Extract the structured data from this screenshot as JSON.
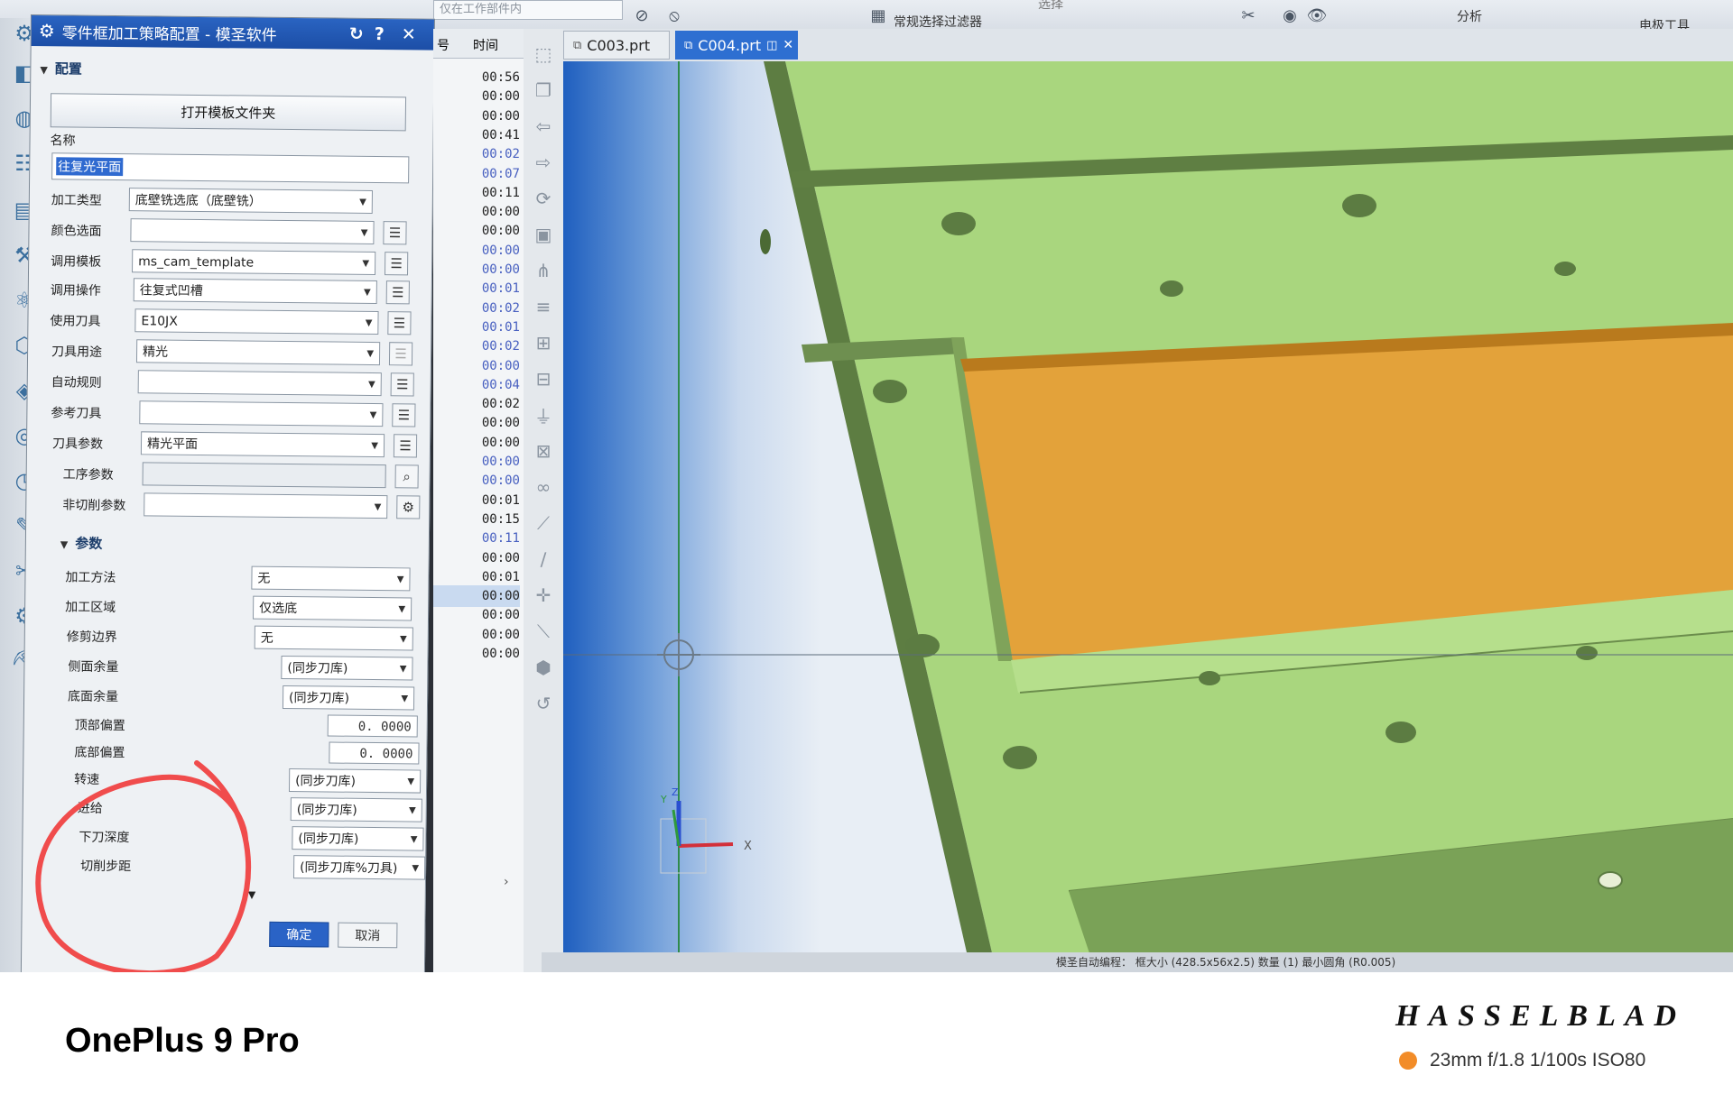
{
  "ribbon": {
    "filter_combo": "仅在工作部件内",
    "select_filter": "常规选择过滤器",
    "top_label": "选择",
    "analysis": "分析",
    "electrode_tools": "电极工具"
  },
  "dialog": {
    "title": "零件框加工策略配置 - 模圣软件",
    "reset_icon": "↻",
    "help_icon": "?",
    "close_icon": "✕",
    "config_section": "配置",
    "open_template_folder": "打开模板文件夹",
    "name_label": "名称",
    "name_value": "往复光平面",
    "rows": [
      {
        "label": "加工类型",
        "value": "底壁铣选底（底壁铣）"
      },
      {
        "label": "颜色选面",
        "value": ""
      },
      {
        "label": "调用模板",
        "value": "ms_cam_template"
      },
      {
        "label": "调用操作",
        "value": "往复式凹槽"
      },
      {
        "label": "使用刀具",
        "value": "E10JX"
      },
      {
        "label": "刀具用途",
        "value": "精光"
      },
      {
        "label": "自动规则",
        "value": ""
      },
      {
        "label": "参考刀具",
        "value": ""
      },
      {
        "label": "刀具参数",
        "value": "精光平面"
      },
      {
        "label": "工序参数",
        "value": ""
      },
      {
        "label": "非切削参数",
        "value": ""
      }
    ],
    "params_section": "参数",
    "params": [
      {
        "label": "加工方法",
        "value": "无"
      },
      {
        "label": "加工区域",
        "value": "仅选底"
      },
      {
        "label": "修剪边界",
        "value": "无"
      },
      {
        "label": "侧面余量",
        "value": "(同步刀库)"
      },
      {
        "label": "底面余量",
        "value": "(同步刀库)"
      },
      {
        "label": "顶部偏置",
        "value": "0. 0000"
      },
      {
        "label": "底部偏置",
        "value": "0. 0000"
      },
      {
        "label": "转速",
        "value": "(同步刀库)"
      },
      {
        "label": "进给",
        "value": "(同步刀库)"
      },
      {
        "label": "下刀深度",
        "value": "(同步刀库)"
      },
      {
        "label": "切削步距",
        "value": "(同步刀库%刀具)"
      }
    ],
    "ok": "确定",
    "cancel": "取消"
  },
  "time_column": {
    "id_header": "号",
    "header": "时间",
    "values": [
      "00:56",
      "00:00",
      "00:00",
      "00:41",
      "00:02",
      "00:07",
      "00:11",
      "00:00",
      "00:00",
      "00:00",
      "00:00",
      "00:01",
      "00:02",
      "00:01",
      "00:02",
      "00:00",
      "00:04",
      "00:02",
      "00:00",
      "00:00",
      "00:00",
      "00:00",
      "00:01",
      "00:15",
      "00:11",
      "00:00",
      "00:01",
      "00:00",
      "00:00",
      "00:00",
      "00:00"
    ],
    "blue_indices": [
      4,
      5,
      9,
      10,
      11,
      12,
      13,
      14,
      15,
      16,
      20,
      21,
      24
    ],
    "selected_index": 27
  },
  "tabs": [
    {
      "label": "C003.prt",
      "active": false
    },
    {
      "label": "C004.prt",
      "active": true
    }
  ],
  "viewport": {
    "part_color": "#a9d67e",
    "part_dark": "#5f7f43",
    "slot_color": "#e3a23a",
    "triad_x": "X",
    "triad_y": "Y",
    "triad_z": "Z"
  },
  "statusbar": "模圣自动编程：  框大小 (428.5x56x2.5)  数量 (1)  最小圆角 (R0.005)",
  "caption": {
    "device": "OnePlus 9 Pro",
    "brand": "HASSELBLAD",
    "exif": "23mm  f/1.8  1/100s  ISO80",
    "dot_color": "#f28c28"
  },
  "annotation_color": "#f04c4c"
}
